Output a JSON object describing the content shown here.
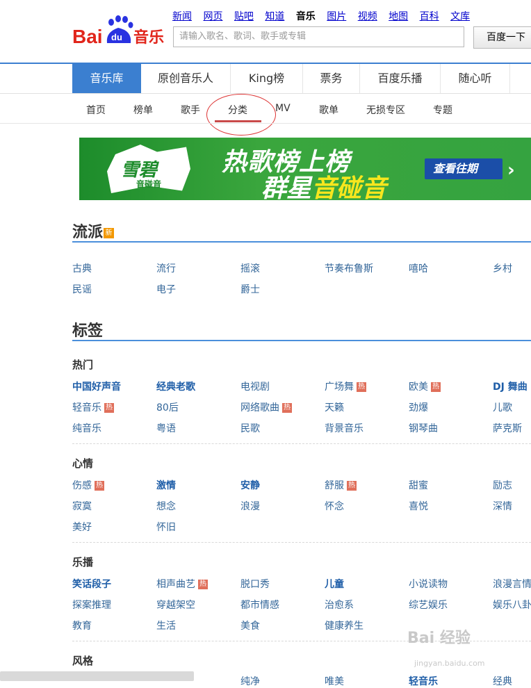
{
  "header": {
    "logo_text": "Bai du 音乐",
    "top_nav": [
      "新闻",
      "网页",
      "贴吧",
      "知道",
      "音乐",
      "图片",
      "视频",
      "地图",
      "百科",
      "文库"
    ],
    "top_nav_current": "音乐",
    "search_placeholder": "请输入歌名、歌词、歌手或专辑",
    "search_button": "百度一下"
  },
  "main_nav": [
    "音乐库",
    "原创音乐人",
    "King榜",
    "票务",
    "百度乐播",
    "随心听"
  ],
  "main_nav_active": "音乐库",
  "sub_nav": [
    "首页",
    "榜单",
    "歌手",
    "分类",
    "MV",
    "歌单",
    "无损专区",
    "专题"
  ],
  "sub_nav_active": "分类",
  "banner": {
    "brand": "雪碧",
    "brand_sub": "音碰音",
    "line1": "热歌榜上榜",
    "line2a": "群星",
    "line2b": "音碰音",
    "cta": "查看往期"
  },
  "sections": {
    "genre_title": "流派",
    "genre_badge": "新",
    "genre_row1": [
      "古典",
      "流行",
      "摇滚",
      "节奏布鲁斯",
      "嘻哈",
      "乡村"
    ],
    "genre_row2": [
      "民谣",
      "电子",
      "爵士"
    ],
    "tags_title": "标签",
    "hot_label": "热",
    "groups": [
      {
        "title": "热门",
        "rows": [
          [
            "中国好声音",
            "经典老歌",
            "电视剧",
            "广场舞",
            "欧美",
            "DJ 舞曲"
          ],
          [
            "轻音乐",
            "80后",
            "网络歌曲",
            "天籁",
            "劲爆",
            "儿歌"
          ],
          [
            "纯音乐",
            "粤语",
            "民歌",
            "背景音乐",
            "钢琴曲",
            "萨克斯"
          ]
        ]
      },
      {
        "title": "心情",
        "rows": [
          [
            "伤感",
            "激情",
            "安静",
            "舒服",
            "甜蜜",
            "励志"
          ],
          [
            "寂寞",
            "想念",
            "浪漫",
            "怀念",
            "喜悦",
            "深情"
          ],
          [
            "美好",
            "怀旧"
          ]
        ]
      },
      {
        "title": "乐播",
        "rows": [
          [
            "笑话段子",
            "相声曲艺",
            "脱口秀",
            "儿童",
            "小说读物",
            "浪漫言情"
          ],
          [
            "探案推理",
            "穿越架空",
            "都市情感",
            "治愈系",
            "综艺娱乐",
            "娱乐八卦"
          ],
          [
            "教育",
            "生活",
            "美食",
            "健康养生"
          ]
        ]
      },
      {
        "title": "风格",
        "rows": [
          [
            "纯净",
            "唯美",
            "轻音乐",
            "经典"
          ]
        ]
      }
    ]
  },
  "watermark": "Bai 经验",
  "watermark_url": "jingyan.baidu.com"
}
